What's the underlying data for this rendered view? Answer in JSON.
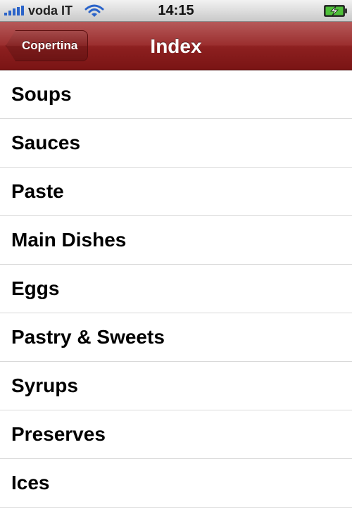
{
  "status_bar": {
    "carrier": "voda IT",
    "time": "14:15",
    "signal_icon": "signal-bars-icon",
    "wifi_icon": "wifi-icon",
    "battery_icon": "battery-charging-icon"
  },
  "nav": {
    "back_label": "Copertina",
    "title": "Index",
    "bar_color": "#8d2020"
  },
  "list": {
    "items": [
      {
        "label": "Soups"
      },
      {
        "label": "Sauces"
      },
      {
        "label": "Paste"
      },
      {
        "label": "Main Dishes"
      },
      {
        "label": "Eggs"
      },
      {
        "label": "Pastry & Sweets"
      },
      {
        "label": "Syrups"
      },
      {
        "label": "Preserves"
      },
      {
        "label": "Ices"
      }
    ]
  }
}
